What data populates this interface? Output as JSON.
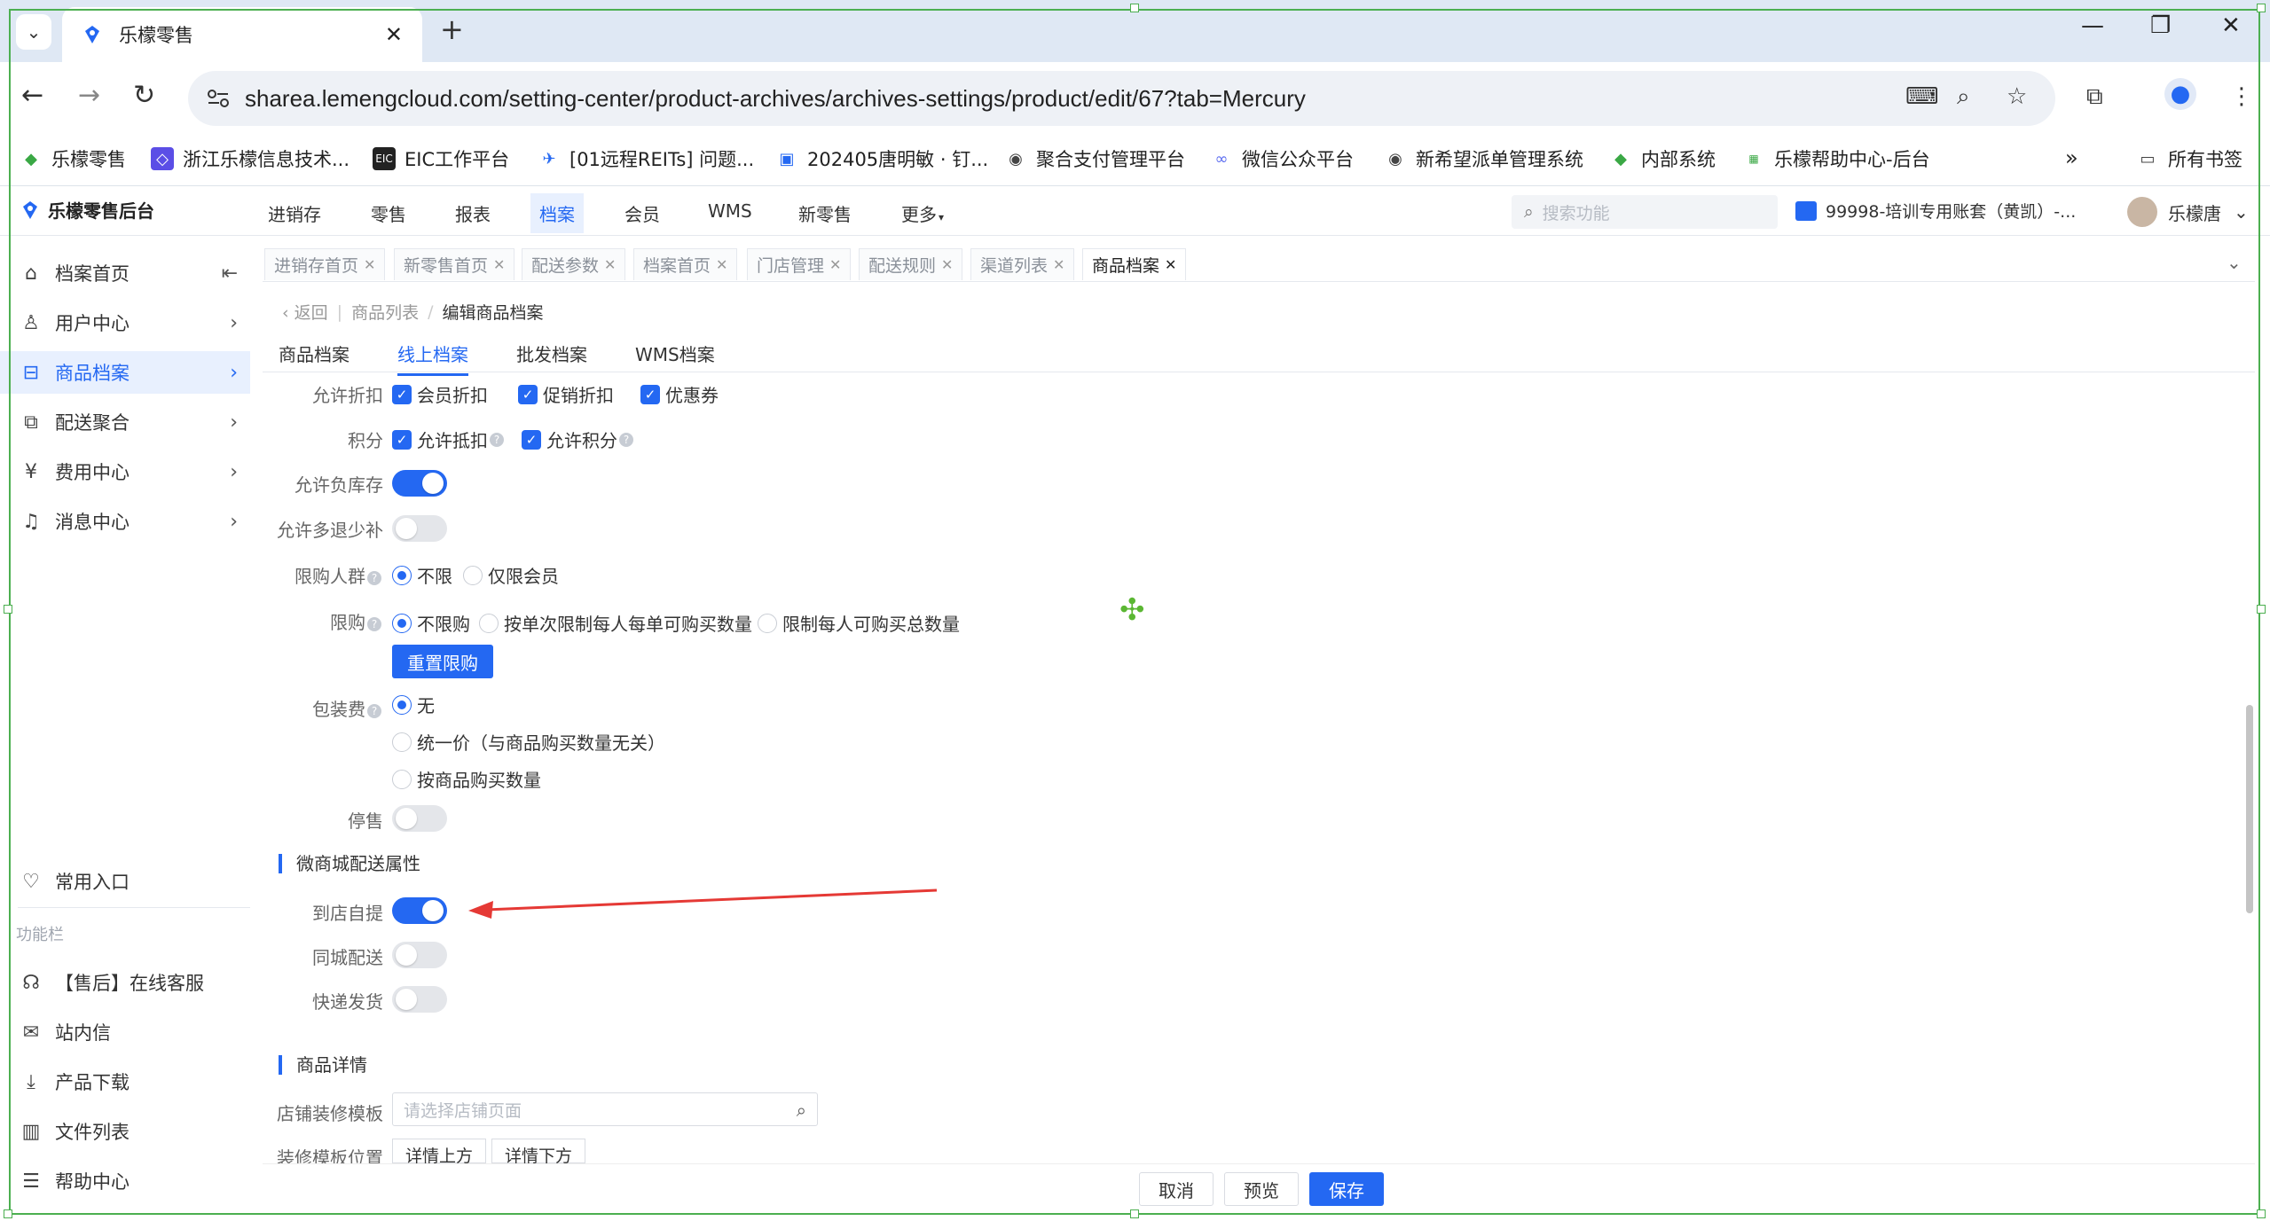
{
  "browser": {
    "tab_title": "乐檬零售",
    "url": "sharea.lemengcloud.com/setting-center/product-archives/archives-settings/product/edit/67?tab=Mercury",
    "bookmarks": [
      "乐檬零售",
      "浙江乐檬信息技术...",
      "EIC工作平台",
      "[01远程REITs] 问题...",
      "202405唐明敏 · 钉...",
      "聚合支付管理平台",
      "微信公众平台",
      "新希望派单管理系统",
      "内部系统",
      "乐檬帮助中心-后台"
    ],
    "all_bookmarks": "所有书签",
    "more": "»"
  },
  "header": {
    "brand": "乐檬零售后台",
    "nav": [
      "进销存",
      "零售",
      "报表",
      "档案",
      "会员",
      "WMS",
      "新零售",
      "更多"
    ],
    "active_nav": "档案",
    "search_placeholder": "搜索功能",
    "account": "99998-培训专用账套（黄凯）-...",
    "user": "乐檬唐"
  },
  "sidebar": {
    "items": [
      "档案首页",
      "用户中心",
      "商品档案",
      "配送聚合",
      "费用中心",
      "消息中心"
    ],
    "active": "商品档案",
    "common": "常用入口",
    "section": "功能栏",
    "tools": [
      "【售后】在线客服",
      "站内信",
      "产品下载",
      "文件列表",
      "帮助中心"
    ]
  },
  "page_tabs": [
    "进销存首页",
    "新零售首页",
    "配送参数",
    "档案首页",
    "门店管理",
    "配送规则",
    "渠道列表",
    "商品档案"
  ],
  "breadcrumb": {
    "back": "返回",
    "list": "商品列表",
    "sep": "/",
    "current": "编辑商品档案"
  },
  "sub_tabs": [
    "商品档案",
    "线上档案",
    "批发档案",
    "WMS档案"
  ],
  "active_sub_tab": "线上档案",
  "form": {
    "discount_label": "允许折扣",
    "discount_opts": [
      "会员折扣",
      "促销折扣",
      "优惠券"
    ],
    "points_label": "积分",
    "points_opts": [
      "允许抵扣",
      "允许积分"
    ],
    "neg_stock_label": "允许负库存",
    "neg_stock_on": true,
    "refund_label": "允许多退少补",
    "refund_on": false,
    "crowd_label": "限购人群",
    "crowd_opts": [
      "不限",
      "仅限会员"
    ],
    "limit_label": "限购",
    "limit_opts": [
      "不限购",
      "按单次限制每人每单可购买数量",
      "限制每人可购买总数量"
    ],
    "reset_btn": "重置限购",
    "pack_label": "包装费",
    "pack_opts": [
      "无",
      "统一价（与商品购买数量无关）",
      "按商品购买数量"
    ],
    "stop_label": "停售",
    "stop_on": false,
    "delivery_section": "微商城配送属性",
    "pickup_label": "到店自提",
    "pickup_on": true,
    "city_label": "同城配送",
    "city_on": false,
    "express_label": "快递发货",
    "express_on": false,
    "detail_section": "商品详情",
    "tpl_label": "店铺装修模板",
    "tpl_placeholder": "请选择店铺页面",
    "pos_label": "装修模板位置",
    "pos_opts": [
      "详情上方",
      "详情下方"
    ]
  },
  "footer": {
    "cancel": "取消",
    "preview": "预览",
    "save": "保存"
  },
  "colors": {
    "primary": "#2468f2",
    "annotation_arrow": "#e53935"
  }
}
